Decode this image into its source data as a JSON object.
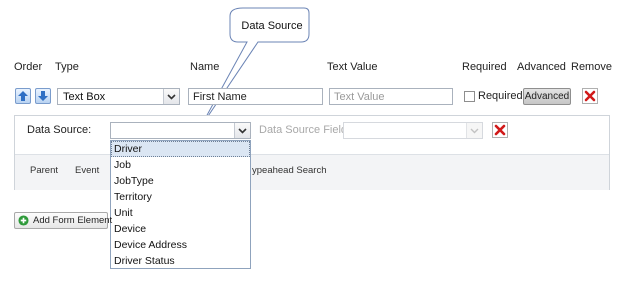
{
  "callout": {
    "text": "Data Source"
  },
  "headers": {
    "order": "Order",
    "type": "Type",
    "name": "Name",
    "text_value": "Text Value",
    "required": "Required",
    "advanced": "Advanced",
    "remove": "Remove"
  },
  "row": {
    "type_value": "Text Box",
    "name_value": "First Name",
    "text_value_placeholder": "Text Value",
    "required_label": "Required",
    "required_checked": false,
    "advanced_button": "Advanced"
  },
  "panel": {
    "data_source_label": "Data Source:",
    "data_source_value": "",
    "data_source_field_label": "Data Source Field:",
    "sub_headers": {
      "parent": "Parent",
      "event": "Event",
      "typeahead": "ypeahead Search"
    }
  },
  "dropdown": {
    "items": [
      "Driver",
      "Job",
      "JobType",
      "Territory",
      "Unit",
      "Device",
      "Device Address",
      "Driver Status"
    ],
    "selected_index": 0
  },
  "add_form_element_button": "Add Form Element",
  "colors": {
    "arrow_blue": "#2f6fc4",
    "delete_red": "#d11a1a",
    "add_green": "#2e9a3a",
    "dropdown_highlight": "#dbe6f3"
  },
  "icons": [
    "arrow-up-icon",
    "arrow-down-icon",
    "chevron-down-icon",
    "close-icon",
    "plus-circle-icon"
  ]
}
